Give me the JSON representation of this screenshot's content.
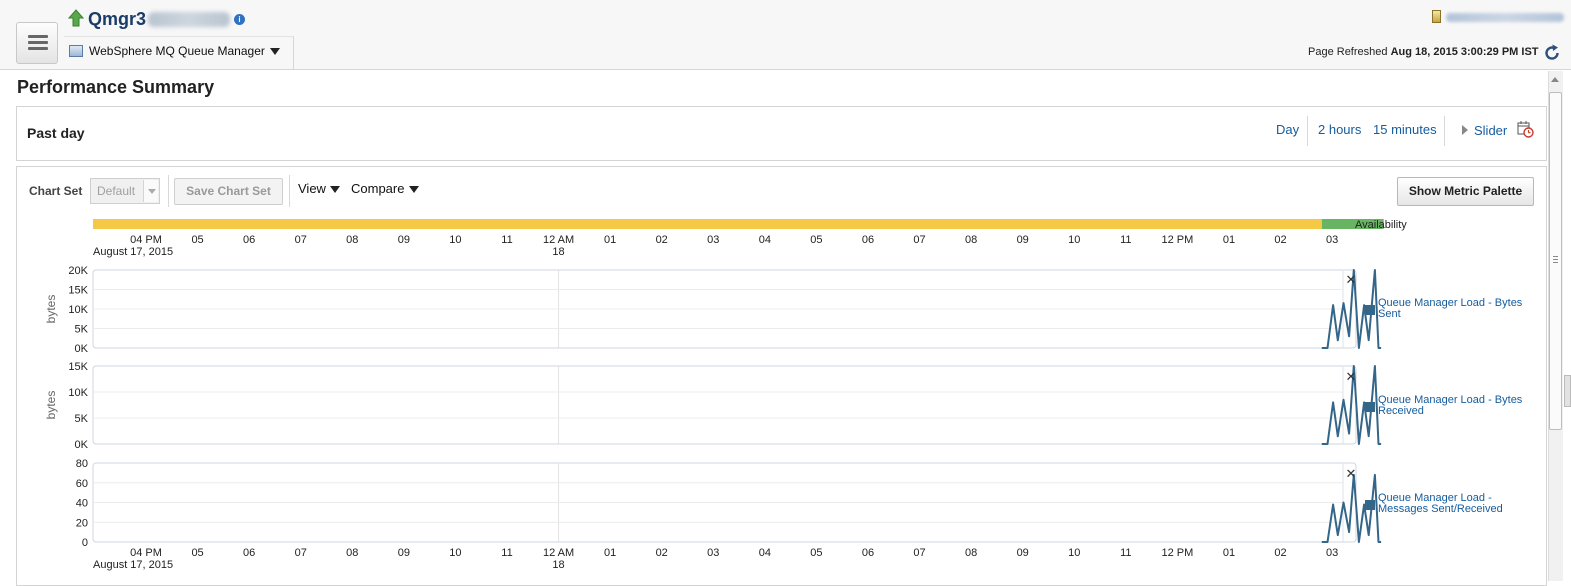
{
  "header": {
    "target_name": "Qmgr3",
    "target_type": "WebSphere MQ Queue Manager",
    "refresh_label": "Page Refreshed",
    "refresh_time": "Aug 18, 2015 3:00:29 PM IST",
    "info_glyph": "i"
  },
  "page": {
    "title": "Performance Summary"
  },
  "time_range": {
    "label": "Past day",
    "options": [
      "Day",
      "2 hours",
      "15 minutes"
    ],
    "slider_label": "Slider"
  },
  "toolbar": {
    "chart_set_label": "Chart Set",
    "chart_set_value": "Default",
    "save_label": "Save Chart Set",
    "view_label": "View",
    "compare_label": "Compare",
    "palette_label": "Show Metric Palette"
  },
  "chart_data": [
    {
      "type": "timeline",
      "name": "Availability",
      "segments": [
        {
          "from_hour": 0,
          "to_hour": 22.8,
          "status": "unknown",
          "color": "#f5c945"
        },
        {
          "from_hour": 22.8,
          "to_hour": 24,
          "status": "up",
          "color": "#67b562"
        }
      ]
    },
    {
      "type": "line",
      "ylabel": "bytes",
      "ylim": [
        0,
        20000
      ],
      "yticks": [
        0,
        5000,
        10000,
        15000,
        20000
      ],
      "ytick_labels": [
        "0K",
        "5K",
        "10K",
        "15K",
        "20K"
      ],
      "series": [
        {
          "name": "Queue Manager Load - Bytes Sent",
          "color": "#336688",
          "x": [
            22.8,
            22.91,
            23.02,
            23.11,
            23.22,
            23.33,
            23.42,
            23.52,
            23.62,
            23.71,
            23.83,
            23.9,
            23.95
          ],
          "values": [
            0,
            0,
            11000,
            2000,
            11500,
            3000,
            20000,
            0,
            11000,
            2000,
            20000,
            0,
            0
          ]
        }
      ]
    },
    {
      "type": "line",
      "ylabel": "bytes",
      "ylim": [
        0,
        15000
      ],
      "yticks": [
        0,
        5000,
        10000,
        15000
      ],
      "ytick_labels": [
        "0K",
        "5K",
        "10K",
        "15K"
      ],
      "series": [
        {
          "name": "Queue Manager Load - Bytes Received",
          "color": "#336688",
          "x": [
            22.8,
            22.91,
            23.02,
            23.11,
            23.22,
            23.33,
            23.42,
            23.52,
            23.62,
            23.71,
            23.83,
            23.9,
            23.95
          ],
          "values": [
            0,
            0,
            8000,
            1500,
            8500,
            2000,
            15000,
            0,
            8000,
            1500,
            15000,
            0,
            0
          ]
        }
      ]
    },
    {
      "type": "line",
      "ylim": [
        0,
        80
      ],
      "yticks": [
        0,
        20,
        40,
        60,
        80
      ],
      "ytick_labels": [
        "0",
        "20",
        "40",
        "60",
        "80"
      ],
      "series": [
        {
          "name": "Queue Manager Load - Messages Sent/Received",
          "color": "#336688",
          "x": [
            22.8,
            22.91,
            23.02,
            23.11,
            23.22,
            23.33,
            23.42,
            23.52,
            23.62,
            23.71,
            23.83,
            23.9,
            23.95
          ],
          "values": [
            0,
            0,
            38,
            7,
            40,
            10,
            68,
            0,
            38,
            7,
            68,
            0,
            0
          ]
        }
      ]
    }
  ],
  "time_axis": {
    "date_label": "August 17, 2015",
    "midnight_label": "18",
    "ticks": [
      "04 PM",
      "05",
      "06",
      "07",
      "08",
      "09",
      "10",
      "11",
      "12 AM",
      "01",
      "02",
      "03",
      "04",
      "05",
      "06",
      "07",
      "08",
      "09",
      "10",
      "11",
      "12 PM",
      "01",
      "02",
      "03"
    ]
  }
}
